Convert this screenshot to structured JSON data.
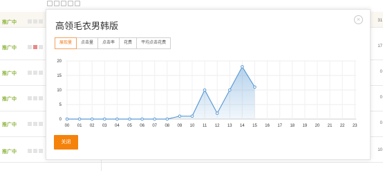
{
  "background": {
    "rows": [
      {
        "status": "推广中",
        "num": "31"
      },
      {
        "status": "推广中",
        "num": "17"
      },
      {
        "status": "推广中",
        "num": "0"
      },
      {
        "status": "推广中",
        "num": "0"
      },
      {
        "status": "推广中",
        "num": "0"
      },
      {
        "status": "推广中",
        "num": "10"
      }
    ]
  },
  "modal": {
    "title": "高领毛衣男韩版",
    "tabs": [
      "展现量",
      "点击量",
      "点击率",
      "花费",
      "平均点击花费"
    ],
    "active_tab": 0,
    "close_button": "关闭",
    "close_icon": "close-circle-icon"
  },
  "chart_data": {
    "type": "area",
    "x": [
      "00",
      "01",
      "02",
      "03",
      "04",
      "05",
      "06",
      "07",
      "08",
      "09",
      "10",
      "11",
      "12",
      "13",
      "14",
      "15",
      "16",
      "17",
      "18",
      "19",
      "20",
      "21",
      "22",
      "23"
    ],
    "series": [
      {
        "values": [
          0,
          0,
          0,
          0,
          0,
          0,
          0,
          0,
          0,
          1,
          1,
          10,
          2,
          10,
          18,
          11
        ]
      }
    ],
    "ylim": [
      0,
      20
    ],
    "yticks": [
      "0",
      "5",
      "10",
      "15",
      "20"
    ],
    "grid": true,
    "color": "#5b9bd5"
  }
}
